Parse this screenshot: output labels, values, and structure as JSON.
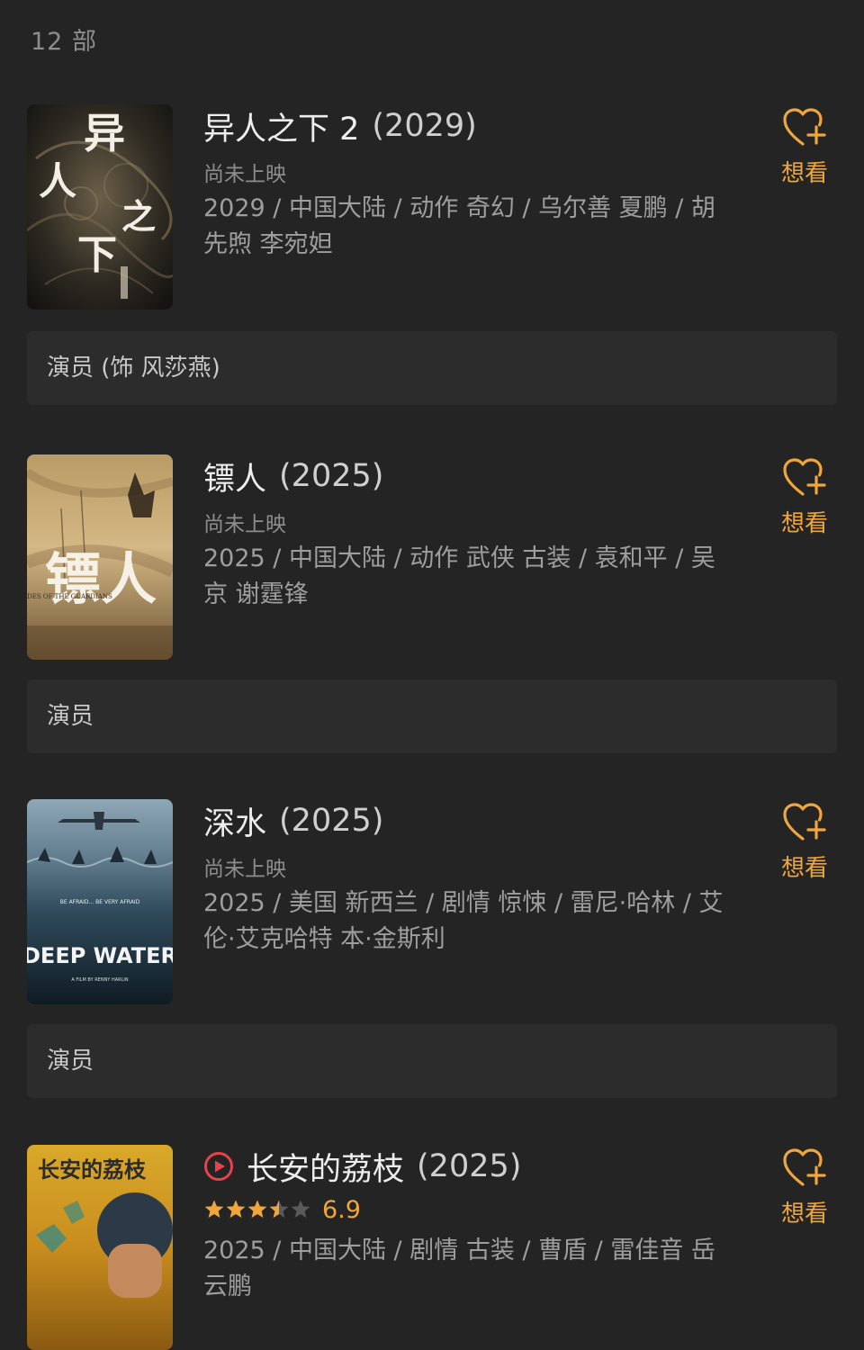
{
  "header": {
    "count": "12 部"
  },
  "movies": [
    {
      "title": "异人之下 2",
      "year": "(2029)",
      "status": "尚未上映",
      "meta": "2029 / 中国大陆 / 动作 奇幻 / 乌尔善 夏鹏 / 胡先煦 李宛妲",
      "want_label": "想看",
      "role": "演员 (饰 风莎燕)",
      "poster_text": "异人之下"
    },
    {
      "title": "镖人",
      "year": "(2025)",
      "status": "尚未上映",
      "meta": "2025 / 中国大陆 / 动作 武侠 古装 / 袁和平 / 吴京 谢霆锋",
      "want_label": "想看",
      "role": "演员",
      "poster_text": "镖人",
      "poster_sub": "BLADES OF THE GUARDIANS"
    },
    {
      "title": "深水",
      "year": "(2025)",
      "status": "尚未上映",
      "meta": "2025 / 美国 新西兰 / 剧情 惊悚 / 雷尼·哈林 / 艾伦·艾克哈特 本·金斯利",
      "want_label": "想看",
      "role": "演员",
      "poster_text": "DEEP WATER",
      "poster_tagline": "BE AFRAID... BE VERY AFRAID",
      "poster_credit": "A FILM BY RENNY HARLIN"
    },
    {
      "title": "长安的荔枝",
      "year": "(2025)",
      "rating": 3.5,
      "score": "6.9",
      "meta": "2025 / 中国大陆 / 剧情 古装 / 曹盾 / 雷佳音 岳云鹏",
      "want_label": "想看",
      "poster_text": "长安的荔枝"
    }
  ],
  "colors": {
    "accent": "#f0a63a",
    "background": "#242424",
    "card": "#2c2c2c"
  }
}
